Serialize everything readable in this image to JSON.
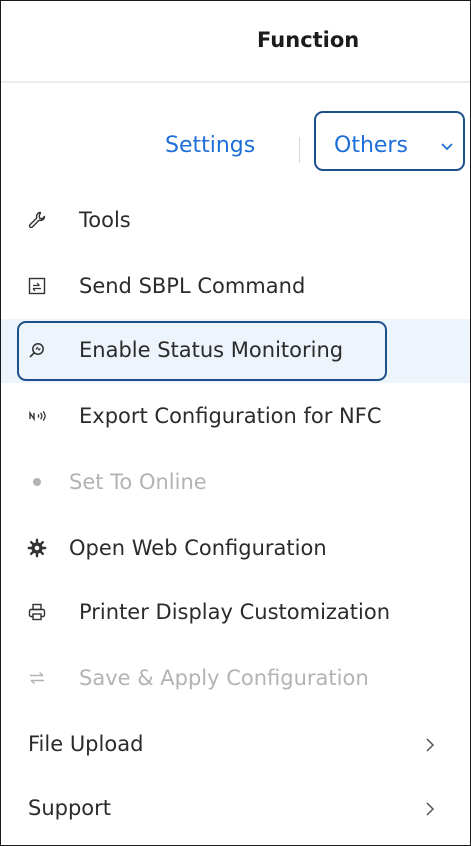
{
  "header": {
    "title": "Function"
  },
  "tabs": {
    "settings_label": "Settings",
    "others_label": "Others"
  },
  "menu": {
    "items": [
      {
        "label": "Tools",
        "icon": "wrench-icon",
        "enabled": true
      },
      {
        "label": "Send SBPL Command",
        "icon": "command-icon",
        "enabled": true
      },
      {
        "label": "Enable Status Monitoring",
        "icon": "monitor-search-icon",
        "enabled": true,
        "highlighted": true
      },
      {
        "label": "Export Configuration for NFC",
        "icon": "nfc-icon",
        "enabled": true
      },
      {
        "label": "Set To Online",
        "icon": "dot-icon",
        "enabled": false
      },
      {
        "label": "Open Web Configuration",
        "icon": "gear-icon",
        "enabled": true
      },
      {
        "label": "Printer Display Customization",
        "icon": "printer-icon",
        "enabled": true
      },
      {
        "label": "Save & Apply Configuration",
        "icon": "swap-arrows-icon",
        "enabled": false
      }
    ],
    "submenus": [
      {
        "label": "File Upload"
      },
      {
        "label": "Support"
      }
    ]
  },
  "colors": {
    "accent": "#1e6fd9",
    "highlight_border": "#1d4f8c",
    "disabled_text": "#b3b3b3"
  }
}
